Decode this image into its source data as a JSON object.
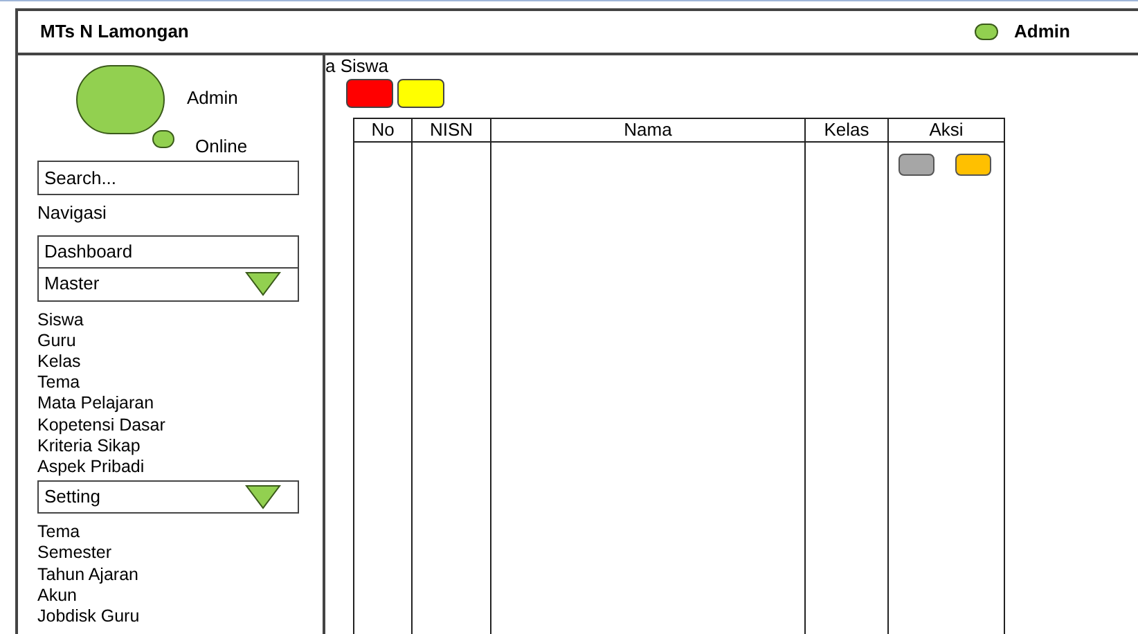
{
  "header": {
    "title": "MTs N Lamongan",
    "user": "Admin"
  },
  "profile": {
    "name": "Admin",
    "status": "Online"
  },
  "search": {
    "placeholder": "Search..."
  },
  "nav_label": "Navigasi",
  "nav": [
    {
      "kind": "link",
      "label": "Dashboard"
    },
    {
      "kind": "group",
      "label": "Master",
      "expanded": true,
      "children": [
        {
          "label": "Siswa"
        },
        {
          "label": "Guru"
        },
        {
          "label": "Kelas"
        },
        {
          "label": "Tema"
        },
        {
          "label": "Mata Pelajaran"
        },
        {
          "label": "Kopetensi Dasar"
        },
        {
          "label": "Kriteria Sikap"
        },
        {
          "label": "Aspek Pribadi"
        }
      ]
    },
    {
      "kind": "group",
      "label": "Setting",
      "expanded": true,
      "children": [
        {
          "label": "Tema"
        },
        {
          "label": "Semester"
        },
        {
          "label": "Tahun Ajaran"
        },
        {
          "label": "Akun"
        },
        {
          "label": "Jobdisk Guru"
        }
      ]
    }
  ],
  "page_title": "a Siswa",
  "toolbar_buttons": [
    {
      "color": "#ff0000"
    },
    {
      "color": "#ffff00"
    }
  ],
  "table": {
    "columns": [
      "No",
      "NISN",
      "Nama",
      "Kelas",
      "Aksi"
    ],
    "action_buttons": [
      {
        "color": "#a6a6a6"
      },
      {
        "color": "#ffc000"
      }
    ]
  }
}
